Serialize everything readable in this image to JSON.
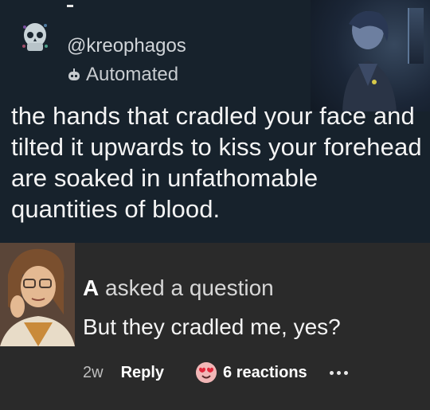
{
  "post": {
    "handle": "@kreophagos",
    "badge": "Automated",
    "text": "the hands that cradled your face and tilted it upwards to kiss your forehead are soaked in unfathomable quantities of blood."
  },
  "answer": {
    "asker_name": "A",
    "asker_suffix": " asked a question",
    "question": "But they cradled me, yes?",
    "footer": {
      "time": "2w",
      "reply_label": "Reply",
      "reactions_label": "6 reactions"
    }
  },
  "icons": {
    "avatar": "skull-avatar-icon",
    "badge": "robot-icon",
    "reaction": "heart-eyes-emoji-icon",
    "more": "ellipsis-icon"
  },
  "colors": {
    "post_bg": "#17222c",
    "card_bg": "#2a2a2a",
    "text_primary": "#f4f4f4",
    "text_secondary": "#c8ccd0"
  }
}
